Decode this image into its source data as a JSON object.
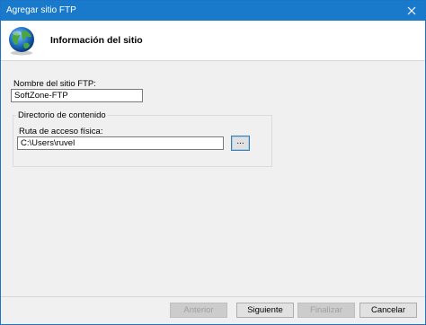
{
  "window": {
    "title": "Agregar sitio FTP",
    "close_icon": "close-icon"
  },
  "header": {
    "title": "Información del sitio",
    "icon": "globe-icon"
  },
  "form": {
    "site_name_label": "Nombre del sitio FTP:",
    "site_name_value": "SoftZone-FTP",
    "content_group_label": "Directorio de contenido",
    "physical_path_label": "Ruta de acceso física:",
    "physical_path_value": "C:\\Users\\ruvel",
    "browse_label": "..."
  },
  "footer": {
    "previous_label": "Anterior",
    "next_label": "Siguiente",
    "finish_label": "Finalizar",
    "cancel_label": "Cancelar"
  }
}
